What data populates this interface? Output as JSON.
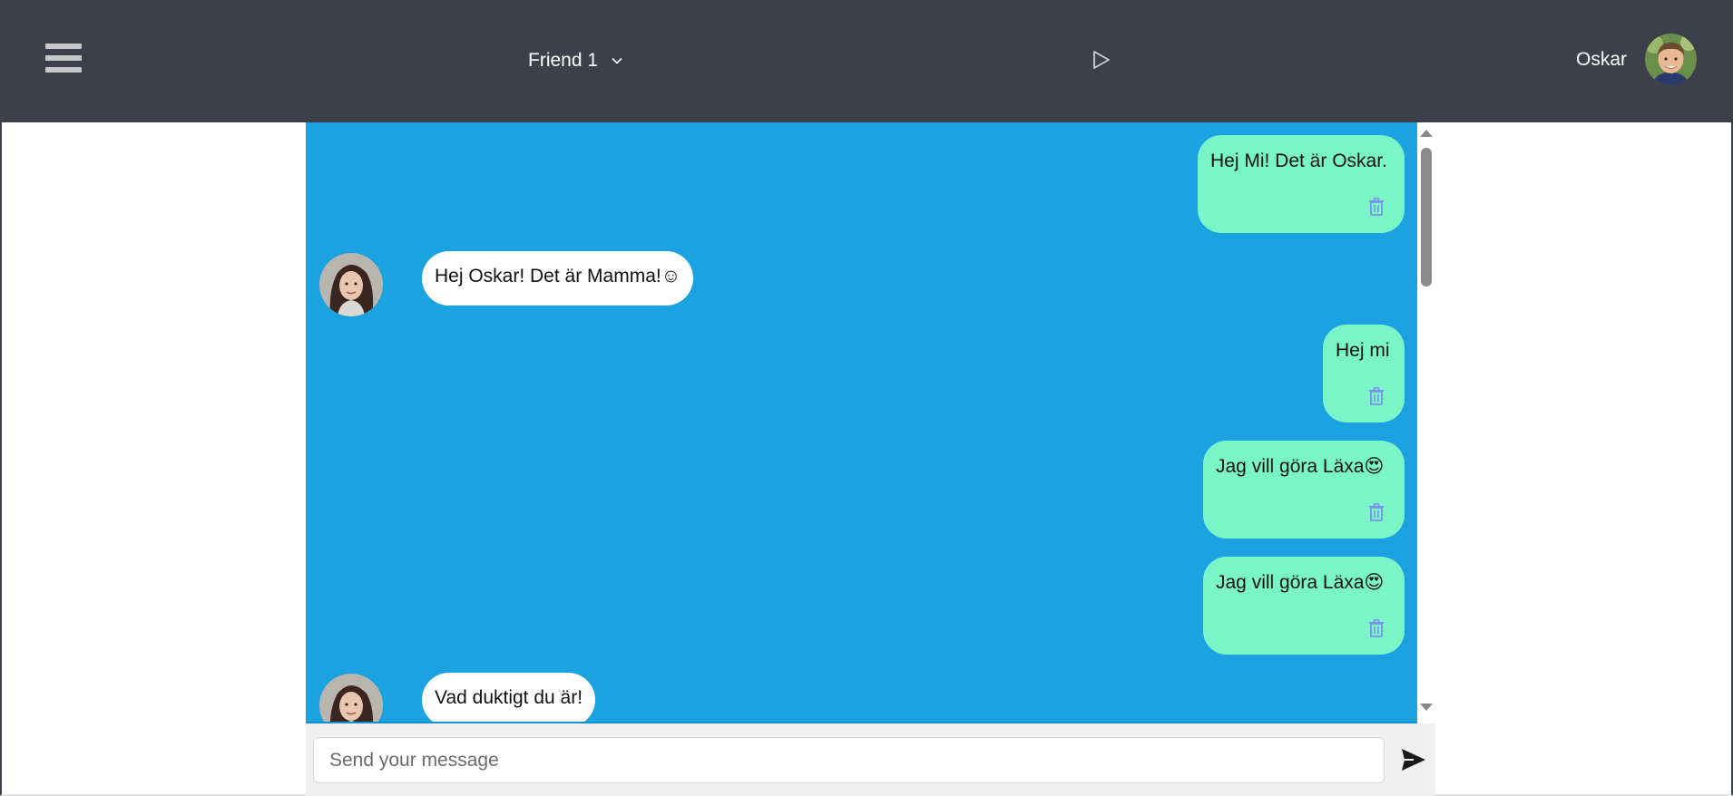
{
  "header": {
    "friend_select": "Friend 1",
    "user_name": "Oskar"
  },
  "messages": [
    {
      "side": "sent",
      "text": "Hej Mi! Det är Oskar."
    },
    {
      "side": "received",
      "text": "Hej Oskar! Det är Mamma!☺"
    },
    {
      "side": "sent",
      "text": "Hej mi"
    },
    {
      "side": "sent",
      "text": "Jag vill göra Läxa😍"
    },
    {
      "side": "sent",
      "text": "Jag vill göra Läxa😍"
    },
    {
      "side": "received",
      "text": "Vad duktigt du är!"
    }
  ],
  "composer": {
    "placeholder": "Send your message"
  },
  "colors": {
    "header_bg": "#3d3f4b",
    "chat_bg": "#1aa3e0",
    "sent_bubble": "#7af5c7",
    "received_bubble": "#ffffff",
    "trash_icon": "#7a8fe8"
  },
  "icons": [
    "hamburger-menu-icon",
    "chevron-down-icon",
    "play-icon",
    "trash-icon",
    "send-icon"
  ]
}
